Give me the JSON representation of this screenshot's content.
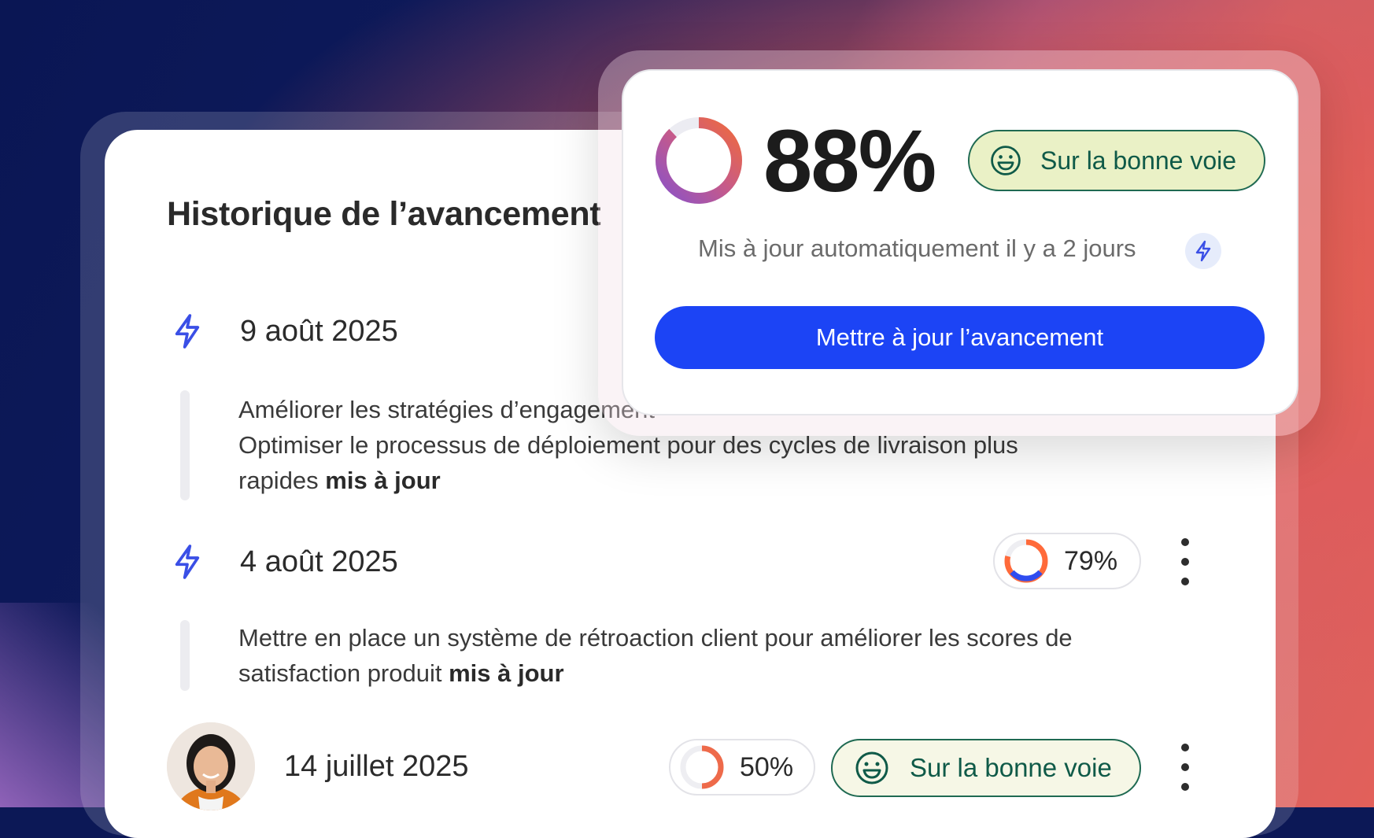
{
  "main": {
    "title": "Historique de l’avancement",
    "entries": [
      {
        "date": "9 août 2025",
        "line1": "Améliorer les stratégies d’engagement",
        "line2": "Optimiser le processus de déploiement pour des cycles de livraison plus",
        "line3_plain": "rapides ",
        "line3_bold": "mis à jour"
      },
      {
        "date": "4 août 2025",
        "progress_value": "79%",
        "progress_fraction": 0.79,
        "line1": "Mettre en place un système de rétroaction client pour améliorer les scores de",
        "line2_plain": "satisfaction produit ",
        "line2_bold": "mis à jour"
      },
      {
        "date": "14 juillet 2025",
        "progress_value": "50%",
        "progress_fraction": 0.5,
        "status": "Sur la bonne voie"
      }
    ]
  },
  "overlay": {
    "progress_value": "88%",
    "progress_fraction": 0.88,
    "status": "Sur la bonne voie",
    "updated_text": "Mis à jour automatiquement il y a 2 jours",
    "button_label": "Mettre à jour l’avancement"
  },
  "colors": {
    "primary_button": "#1c44f5",
    "status_border": "#1f6a52",
    "status_text": "#0f5a48",
    "status_bg_overlay": "#eaf1c6",
    "bolt_icon": "#3a4fe6"
  },
  "icons": {
    "entry_icon": "lightning-bolt-icon",
    "status_icon": "smiley-face-icon",
    "menu_icon": "kebab-menu-icon"
  }
}
